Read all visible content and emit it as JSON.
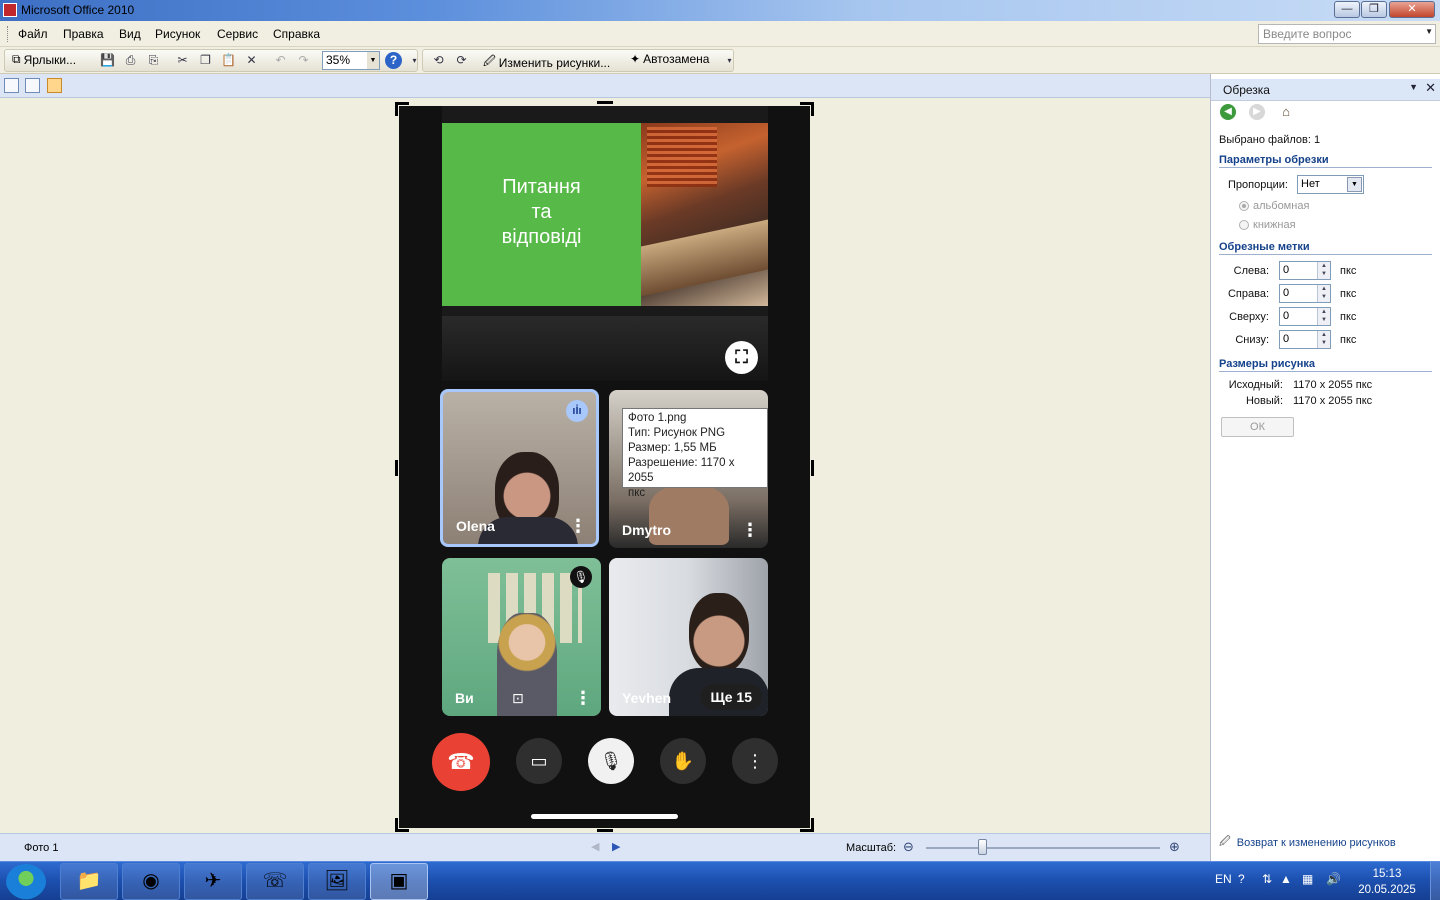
{
  "window": {
    "title": "Microsoft Office 2010",
    "minimize": "—",
    "maximize": "❐",
    "close": "✕"
  },
  "menu": {
    "items": [
      "Файл",
      "Правка",
      "Вид",
      "Рисунок",
      "Сервис",
      "Справка"
    ],
    "ask_placeholder": "Введите вопрос"
  },
  "toolbar": {
    "shortcuts_label": "Ярлыки...",
    "zoom_value": "35%",
    "edit_pictures_label": "Изменить рисунки...",
    "autocorrect_label": "Автозамена"
  },
  "photo": {
    "slide_text": "Питання\nта\nвідповіді",
    "participants": [
      {
        "name": "Olena"
      },
      {
        "name": "Dmytro"
      },
      {
        "name": "Ви"
      },
      {
        "name": "Yevhen"
      }
    ],
    "more_label": "Ще 15"
  },
  "tooltip": {
    "line1": "Фото 1.png",
    "line2": "Тип: Рисунок PNG",
    "line3": "Размер: 1,55 МБ",
    "line4": "Разрешение: 1170 x 2055",
    "line5": "пкс"
  },
  "taskpane": {
    "title": "Обрезка",
    "selected_files": "Выбрано файлов: 1",
    "crop_params_title": "Параметры обрезки",
    "proportions_label": "Пропорции:",
    "proportions_value": "Нет",
    "landscape_label": "альбомная",
    "portrait_label": "книжная",
    "crop_marks_title": "Обрезные метки",
    "marks": [
      {
        "label": "Слева:",
        "value": "0",
        "unit": "пкс"
      },
      {
        "label": "Справа:",
        "value": "0",
        "unit": "пкс"
      },
      {
        "label": "Сверху:",
        "value": "0",
        "unit": "пкс"
      },
      {
        "label": "Снизу:",
        "value": "0",
        "unit": "пкс"
      }
    ],
    "size_title": "Размеры рисунка",
    "original_label": "Исходный:",
    "original_value": "1170 x 2055 пкс",
    "new_label": "Новый:",
    "new_value": "1170 x 2055 пкс",
    "ok_label": "ОК",
    "footer_link": "Возврат к изменению рисунков"
  },
  "statusbar": {
    "file_label": "Фото 1",
    "zoom_label": "Масштаб:",
    "zoom_level": 0.24
  },
  "taskbar": {
    "lang": "EN",
    "time": "15:13",
    "date": "20.05.2025"
  },
  "colors": {
    "meet_end_call": "#e94235",
    "slide_green": "#57b947",
    "speaking_border": "#a8c7fa",
    "pane_section": "#15428b"
  }
}
